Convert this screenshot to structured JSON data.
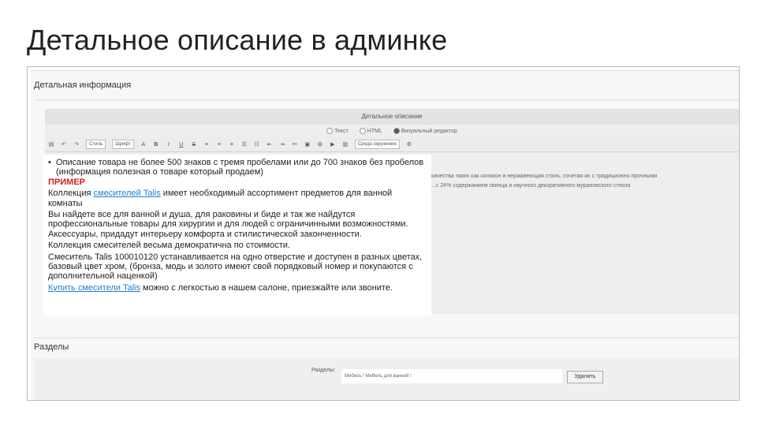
{
  "slide": {
    "title": "Детальное описание в админке"
  },
  "admin": {
    "section_detail": "Детальная информация",
    "desc_title": "Детальное описание",
    "modes": [
      {
        "label": "Текст",
        "selected": false
      },
      {
        "label": "HTML",
        "selected": false
      },
      {
        "label": "Визуальный редактор",
        "selected": true
      }
    ],
    "toolbar": {
      "style_select": "Стиль",
      "font_select": "Шрифт",
      "bold": "B",
      "italic": "I",
      "underline": "U",
      "strike": "S",
      "env_select": "Среда окружения"
    },
    "right_text": [
      "качества таких как силикон и нержавеющая сталь, сочетая их с традиционно прочными",
      "...с 24% содержанием свинца и научного декоративного мурановского стекла"
    ],
    "editor": {
      "bullet_text": "Описание товара не более 500 знаков с тремя пробелами или до 700 знаков без пробелов (информация полезная о товаре который продаем)",
      "example_label": "ПРИМЕР",
      "p1_a": "Коллекция ",
      "p1_link": "смесителей Talis",
      "p1_b": " имеет необходимый ассортимент предметов  для ванной комнаты",
      "p2": "Вы найдете все для ванной и душа, для раковины и биде и так же найдутся профессиональные товары для хирургии и для людей с ограничинными возможностями. Аксессуары, придадут интерьеру комфорта и стилистической законченности.",
      "p3": "Коллекция смесителей  весьма демократична по стоимости.",
      "p4": "Смеситель Talis  100010120  устанавливается на одно отверстие и доступен в разных цветах, базовый цвет хром, (бронза, модь и золото имеют свой порядковый номер и покупаются с дополнительной наценкой)",
      "p5_link": "Купить смесители Talis",
      "p5_b": " можно с легкостью в нашем салоне, приезжайте или звоните."
    },
    "section_sections": "Разделы",
    "bottom": {
      "label": "Разделы:",
      "field_value": "Мебель / Мебель для ванной /",
      "delete_button": "Удалить"
    }
  }
}
